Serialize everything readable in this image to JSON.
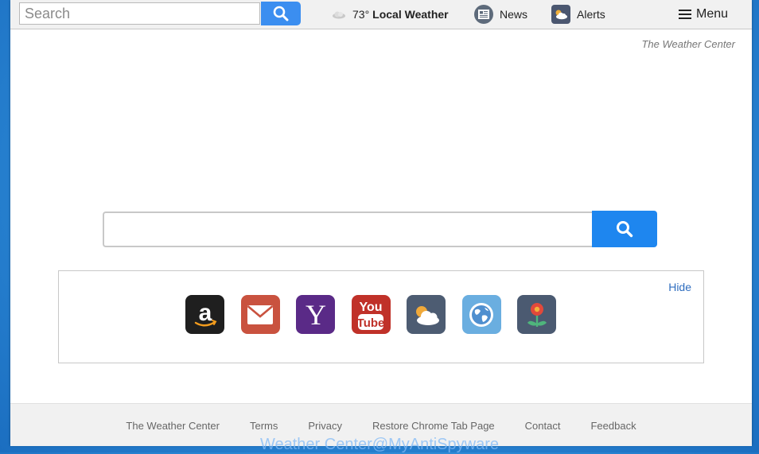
{
  "topbar": {
    "search_placeholder": "Search",
    "weather": {
      "temp": "73°",
      "label": "Local Weather"
    },
    "news_label": "News",
    "alerts_label": "Alerts",
    "menu_label": "Menu"
  },
  "brand": "The Weather Center",
  "main_search": {
    "value": ""
  },
  "shortcuts": {
    "hide_label": "Hide",
    "tiles": [
      {
        "name": "amazon",
        "color": "#1f1f1f"
      },
      {
        "name": "gmail",
        "color": "#c9523f"
      },
      {
        "name": "yahoo",
        "color": "#5a2a87"
      },
      {
        "name": "youtube",
        "color": "#c03129"
      },
      {
        "name": "weather",
        "color": "#4d5c72"
      },
      {
        "name": "web",
        "color": "#6aaee0"
      },
      {
        "name": "flower",
        "color": "#4b5a71"
      }
    ]
  },
  "footer": {
    "links": [
      "The Weather Center",
      "Terms",
      "Privacy",
      "Restore Chrome Tab Page",
      "Contact",
      "Feedback"
    ]
  },
  "watermark": "Weather Center@MyAntiSpyware"
}
